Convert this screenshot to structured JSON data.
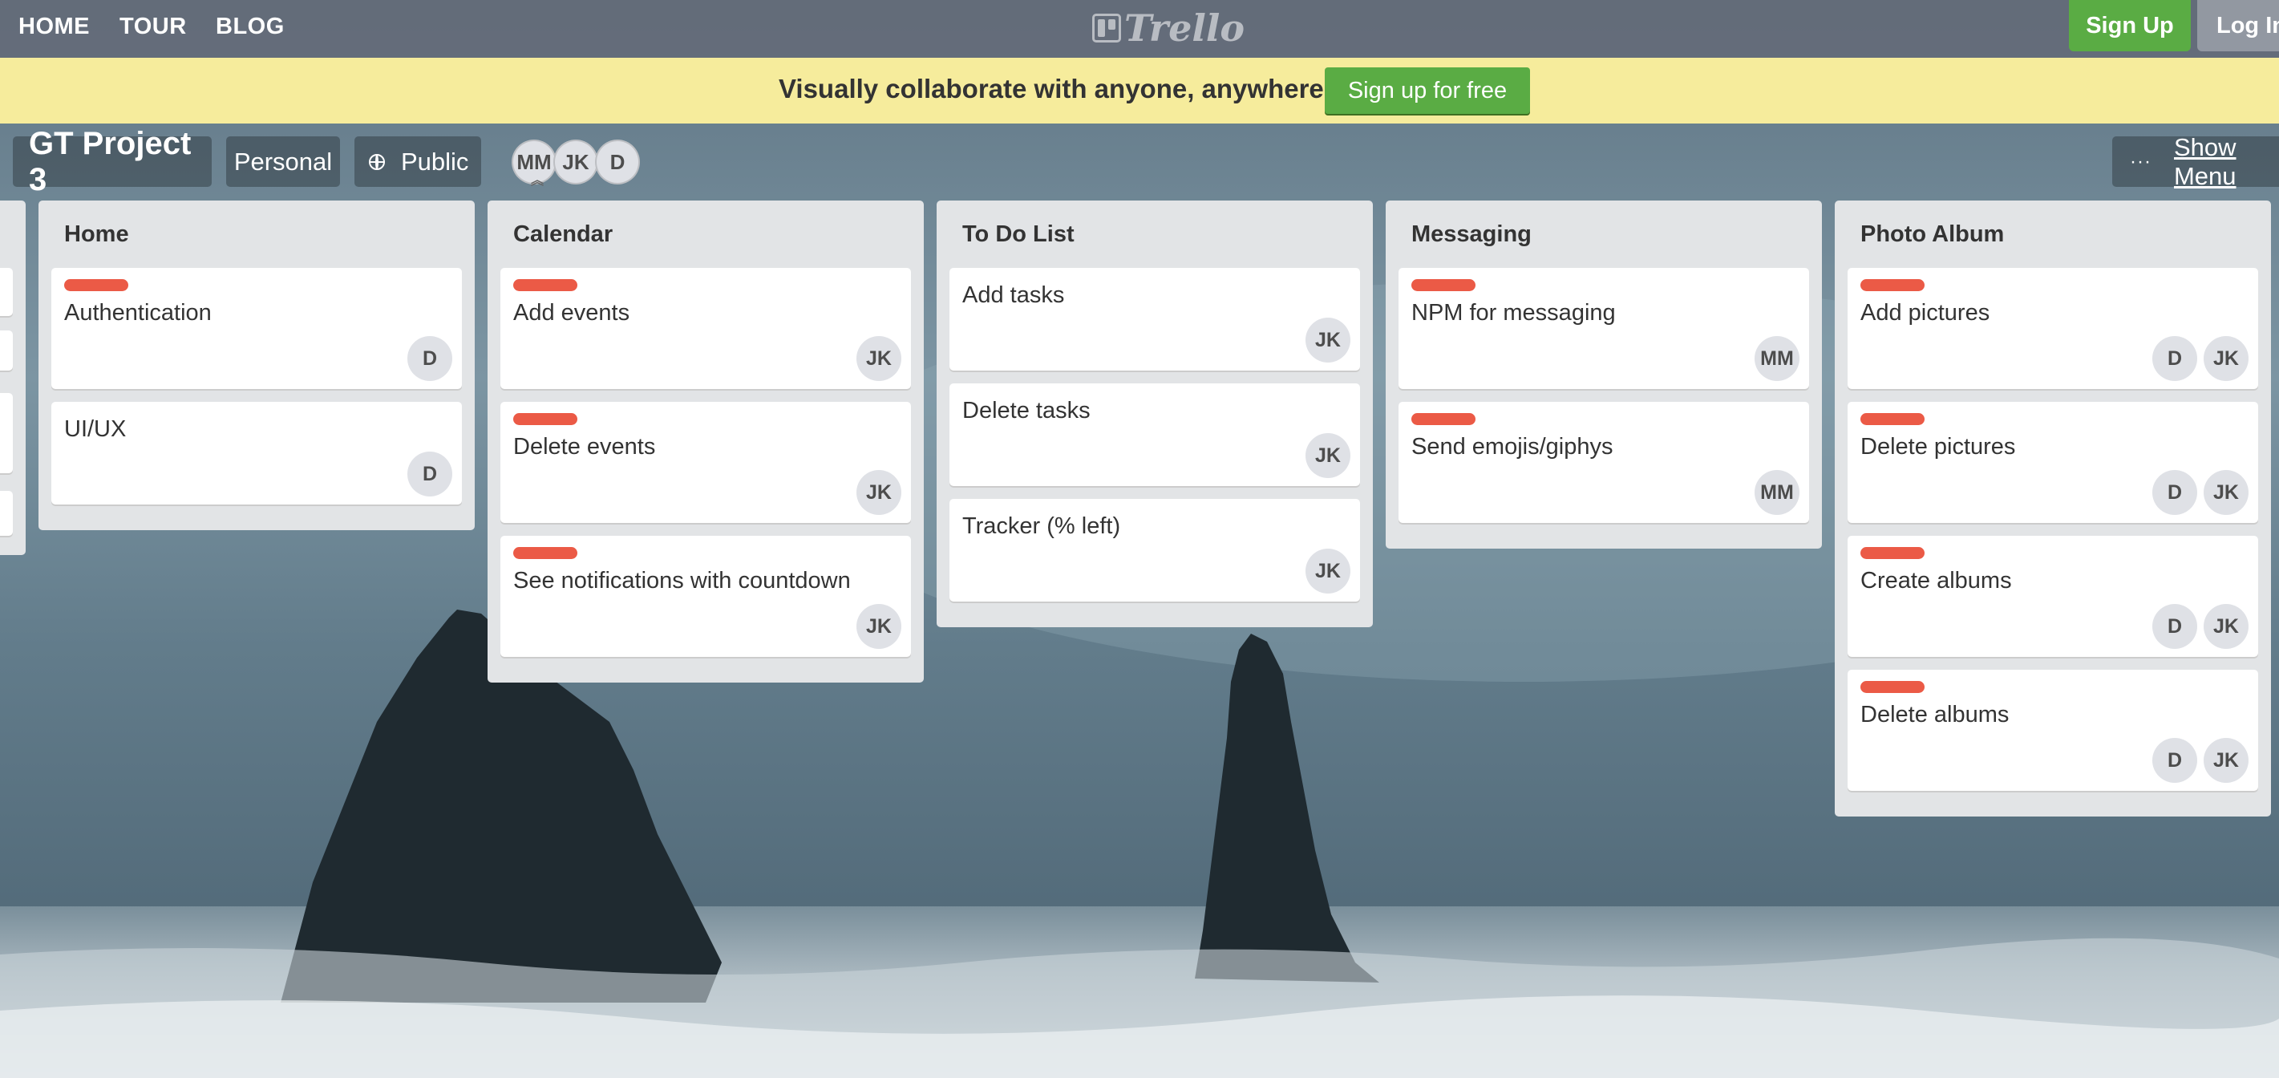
{
  "nav": {
    "links": [
      "HOME",
      "TOUR",
      "BLOG"
    ],
    "logo_text": "Trello",
    "signup_label": "Sign Up",
    "login_label": "Log In"
  },
  "banner": {
    "text": "Visually collaborate with anyone, anywhere.",
    "button_label": "Sign up for free"
  },
  "board": {
    "title": "GT Project 3",
    "team": "Personal",
    "visibility": "Public",
    "members": [
      "MM",
      "JK",
      "D"
    ],
    "menu_label": "Show Menu"
  },
  "lists": [
    {
      "title": "Home",
      "cards": [
        {
          "text": "Authentication",
          "label": true,
          "members": [
            "D"
          ]
        },
        {
          "text": "UI/UX",
          "label": false,
          "members": [
            "D"
          ]
        }
      ]
    },
    {
      "title": "Calendar",
      "cards": [
        {
          "text": "Add events",
          "label": true,
          "members": [
            "JK"
          ]
        },
        {
          "text": "Delete events",
          "label": true,
          "members": [
            "JK"
          ]
        },
        {
          "text": "See notifications with countdown",
          "label": true,
          "members": [
            "JK"
          ]
        }
      ]
    },
    {
      "title": "To Do List",
      "cards": [
        {
          "text": "Add tasks",
          "label": false,
          "members": [
            "JK"
          ]
        },
        {
          "text": "Delete tasks",
          "label": false,
          "members": [
            "JK"
          ]
        },
        {
          "text": "Tracker (% left)",
          "label": false,
          "members": [
            "JK"
          ]
        }
      ]
    },
    {
      "title": "Messaging",
      "cards": [
        {
          "text": "NPM for messaging",
          "label": true,
          "members": [
            "MM"
          ]
        },
        {
          "text": "Send emojis/giphys",
          "label": true,
          "members": [
            "MM"
          ]
        }
      ]
    },
    {
      "title": "Photo Album",
      "cards": [
        {
          "text": "Add pictures",
          "label": true,
          "members": [
            "D",
            "JK"
          ]
        },
        {
          "text": "Delete pictures",
          "label": true,
          "members": [
            "D",
            "JK"
          ]
        },
        {
          "text": "Create albums",
          "label": true,
          "members": [
            "D",
            "JK"
          ]
        },
        {
          "text": "Delete albums",
          "label": true,
          "members": [
            "D",
            "JK"
          ]
        }
      ]
    }
  ],
  "colors": {
    "label_red": "#eb5a46",
    "green": "#5aac44",
    "banner_yellow": "#f6ec9c",
    "list_bg": "#e2e4e6"
  }
}
